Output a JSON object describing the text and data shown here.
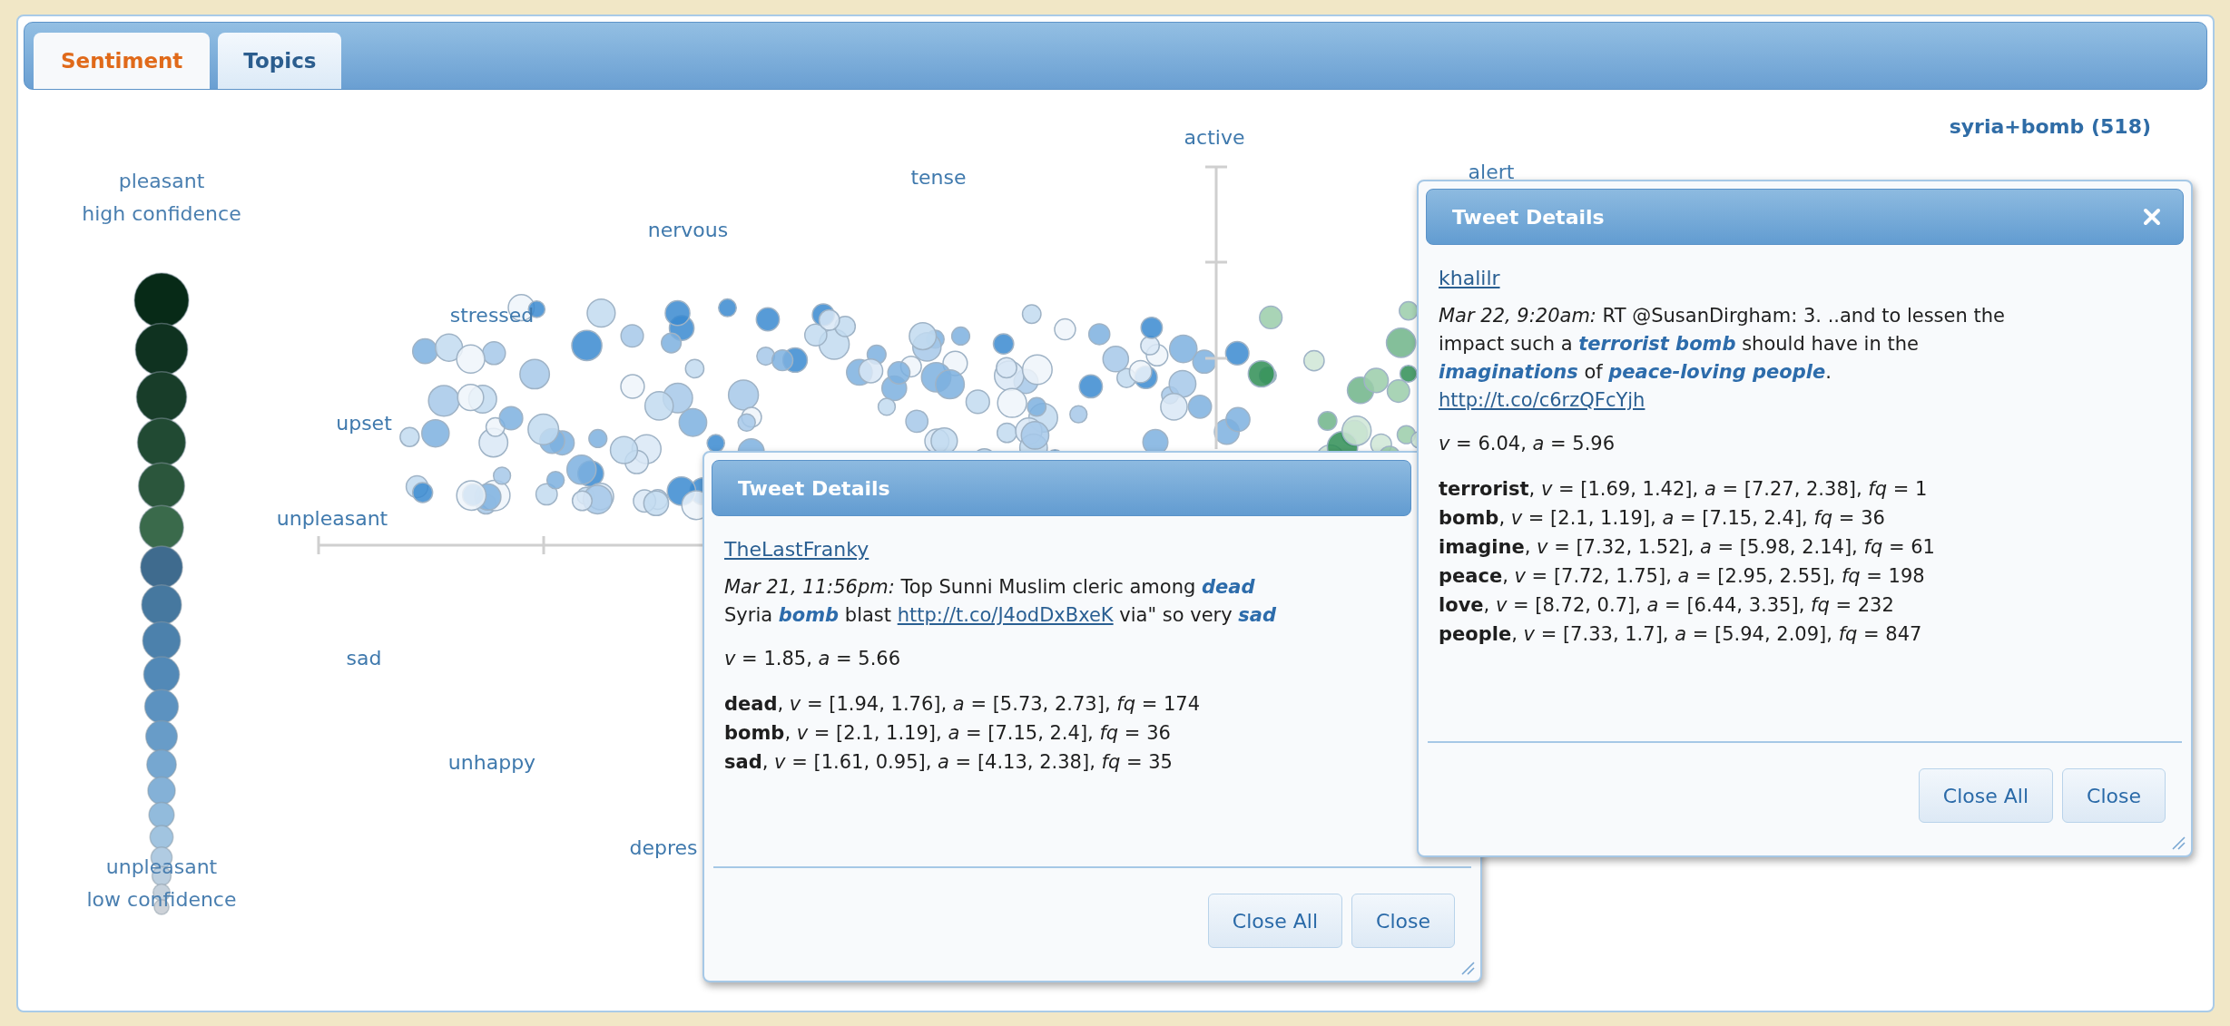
{
  "tabs": [
    {
      "label": "Sentiment",
      "selected": true
    },
    {
      "label": "Topics",
      "selected": false
    }
  ],
  "query": "syria+bomb (518)",
  "legend": {
    "top": [
      "pleasant",
      "high confidence"
    ],
    "bottom": [
      "unpleasant",
      "low confidence"
    ]
  },
  "plot_labels": [
    "active",
    "tense",
    "nervous",
    "stressed",
    "upset",
    "unpleasant",
    "sad",
    "unhappy",
    "depres",
    "alert"
  ],
  "dialogs": [
    {
      "title": "Tweet Details",
      "user": "TheLastFranky",
      "lines": [
        [
          {
            "kind": "date",
            "text": "Mar 21, 11:56pm:"
          },
          {
            "kind": "plain",
            "text": " Top Sunni Muslim cleric among "
          },
          {
            "kind": "keyword",
            "text": "dead"
          }
        ],
        [
          {
            "kind": "plain",
            "text": "Syria "
          },
          {
            "kind": "keyword",
            "text": "bomb"
          },
          {
            "kind": "plain",
            "text": " blast "
          },
          {
            "kind": "link",
            "text": "http://t.co/J4odDxBxeK"
          },
          {
            "kind": "plain",
            "text": " via\" so very "
          },
          {
            "kind": "keyword",
            "text": "sad"
          }
        ]
      ],
      "score": "*v* = 1.85, *a* = 5.66",
      "words": [
        "**dead**, *v* = [1.94, 1.76], *a* = [5.73, 2.73], *fq* = 174",
        "**bomb**, *v* = [2.1, 1.19], *a* = [7.15, 2.4], *fq* = 36",
        "**sad**, *v* = [1.61, 0.95], *a* = [4.13, 2.38], *fq* = 35"
      ],
      "buttons": [
        "Close All",
        "Close"
      ]
    },
    {
      "title": "Tweet Details",
      "close_icon": true,
      "user": "khalilr",
      "lines": [
        [
          {
            "kind": "date",
            "text": "Mar 22, 9:20am:"
          },
          {
            "kind": "plain",
            "text": " RT @SusanDirgham: 3. ..and to lessen the"
          }
        ],
        [
          {
            "kind": "plain",
            "text": "impact such a "
          },
          {
            "kind": "keyword",
            "text": "terrorist bomb"
          },
          {
            "kind": "plain",
            "text": " should have in the"
          }
        ],
        [
          {
            "kind": "keyword",
            "text": "imaginations"
          },
          {
            "kind": "plain",
            "text": " of "
          },
          {
            "kind": "keyword",
            "text": "peace-loving people"
          },
          {
            "kind": "plain",
            "text": "."
          }
        ],
        [
          {
            "kind": "link",
            "text": "http://t.co/c6rzQFcYjh"
          }
        ]
      ],
      "score": "*v* = 6.04, *a* = 5.96",
      "words": [
        "**terrorist**, *v* = [1.69, 1.42], *a* = [7.27, 2.38], *fq* = 1",
        "**bomb**, *v* = [2.1, 1.19], *a* = [7.15, 2.4], *fq* = 36",
        "**imagine**, *v* = [7.32, 1.52], *a* = [5.98, 2.14], *fq* = 61",
        "**peace**, *v* = [7.72, 1.75], *a* = [2.95, 2.55], *fq* = 198",
        "**love**, *v* = [8.72, 0.7], *a* = [6.44, 3.35], *fq* = 232",
        "**people**, *v* = [7.33, 1.7], *a* = [5.94, 2.09], *fq* = 847"
      ],
      "buttons": [
        "Close All",
        "Close"
      ]
    }
  ]
}
